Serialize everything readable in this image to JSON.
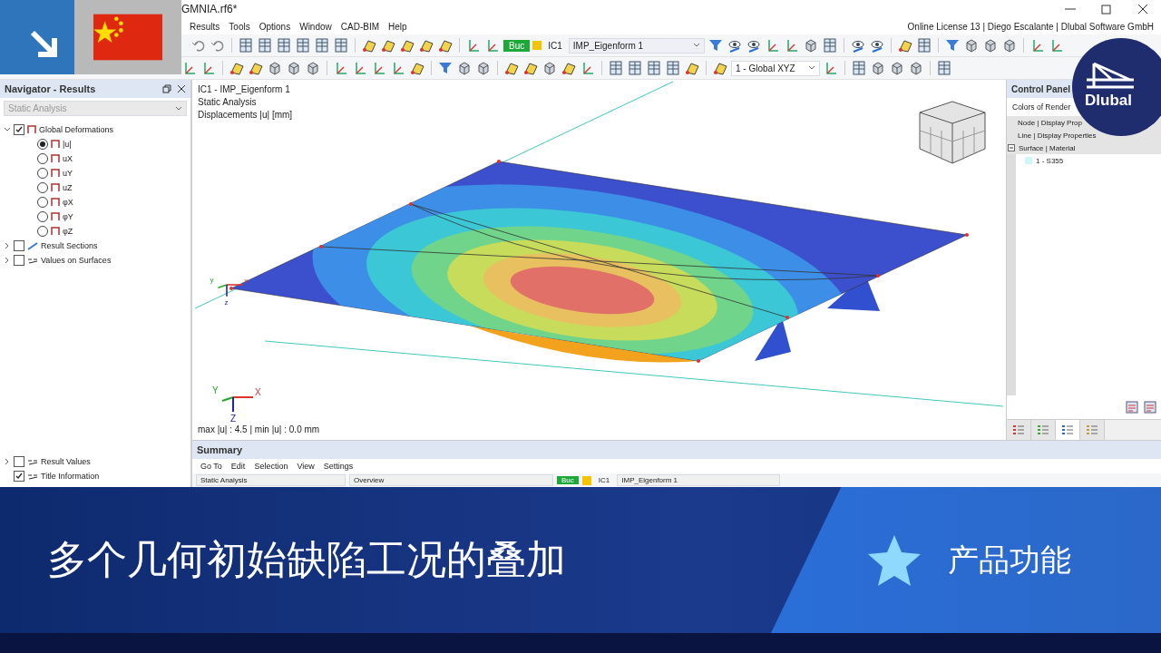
{
  "window": {
    "title": "GMNIA.rf6*"
  },
  "menu": [
    "Results",
    "Tools",
    "Options",
    "Window",
    "CAD-BIM",
    "Help"
  ],
  "license": "Online License 13 | Diego Escalante | Dlubal Software GmbH",
  "toolbar": {
    "load_type": "Buc",
    "load_case": "IC1",
    "load_case_name": "IMP_Eigenform 1",
    "coordinate_system": "1 - Global XYZ"
  },
  "navigator": {
    "title": "Navigator - Results",
    "combo": "Static Analysis",
    "tree": [
      {
        "label": "Global Deformations",
        "kind": "checkbox",
        "checked": true,
        "expanded": true,
        "children": [
          {
            "label": "|u|",
            "kind": "radio",
            "selected": true
          },
          {
            "label": "uX",
            "kind": "radio",
            "selected": false
          },
          {
            "label": "uY",
            "kind": "radio",
            "selected": false
          },
          {
            "label": "uZ",
            "kind": "radio",
            "selected": false
          },
          {
            "label": "φX",
            "kind": "radio",
            "selected": false
          },
          {
            "label": "φY",
            "kind": "radio",
            "selected": false
          },
          {
            "label": "φZ",
            "kind": "radio",
            "selected": false
          }
        ]
      },
      {
        "label": "Result Sections",
        "kind": "checkbox",
        "checked": false,
        "expanded": false
      },
      {
        "label": "Values on Surfaces",
        "kind": "checkbox",
        "checked": false,
        "expanded": false
      }
    ],
    "bottom_tree": [
      {
        "label": "Result Values",
        "kind": "checkbox",
        "checked": false,
        "expanded": false
      },
      {
        "label": "Title Information",
        "kind": "checkbox",
        "checked": true
      }
    ]
  },
  "viewport": {
    "info": [
      "IC1 - IMP_Eigenform 1",
      "Static Analysis",
      "Displacements |u| [mm]"
    ],
    "summary_line": "max |u| : 4.5 | min |u| : 0.0 mm",
    "axis_triads": [
      {
        "labels": [
          "x",
          "y",
          "z"
        ]
      },
      {
        "labels": [
          "X",
          "Y",
          "Z"
        ]
      }
    ]
  },
  "control_panel": {
    "title": "Control Panel",
    "combo": "Colors of Render",
    "items": [
      {
        "label": "Node | Display Prop"
      },
      {
        "label": "Line | Display Properties"
      },
      {
        "label": "Surface | Material",
        "expanded": true,
        "children": [
          {
            "label": "1 - S355"
          }
        ]
      }
    ],
    "tabs": [
      {
        "selected": false
      },
      {
        "selected": false
      },
      {
        "selected": true
      },
      {
        "selected": false
      }
    ]
  },
  "summary": {
    "title": "Summary",
    "menu": [
      "Go To",
      "Edit",
      "Selection",
      "View",
      "Settings"
    ],
    "analysis": "Static Analysis",
    "view": "Overview",
    "load_type": "Buc",
    "load_case": "IC1",
    "load_case_name": "IMP_Eigenform 1"
  },
  "logo": {
    "text": "Dlubal"
  },
  "banner": {
    "title": "多个几何初始缺陷工况的叠加",
    "tag": "产品功能"
  }
}
